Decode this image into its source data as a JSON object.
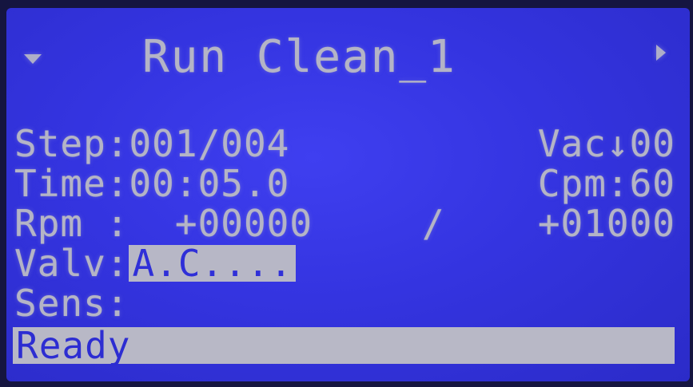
{
  "title": {
    "text": "Run Clean_1",
    "left_icon": "triangle-down-icon",
    "right_icon": "triangle-right-icon"
  },
  "rows": {
    "step": {
      "label": "Step:",
      "value": "001/004"
    },
    "vac": {
      "text": "Vac↓00"
    },
    "time": {
      "label": "Time:",
      "value": "00:05.0"
    },
    "cpm": {
      "text": "Cpm:60"
    },
    "rpm": {
      "label": "Rpm :",
      "value": "+00000",
      "separator": "/",
      "target": "+01000"
    },
    "valv": {
      "label": "Valv:",
      "value": "A.C...."
    },
    "sens": {
      "label": "Sens:"
    }
  },
  "status": {
    "text": "Ready"
  },
  "colors": {
    "lcd_background": "#3838e4",
    "text": "#b8b8c8",
    "highlight_bar": "#b8b8c6",
    "highlight_text": "#2d2dd2"
  }
}
